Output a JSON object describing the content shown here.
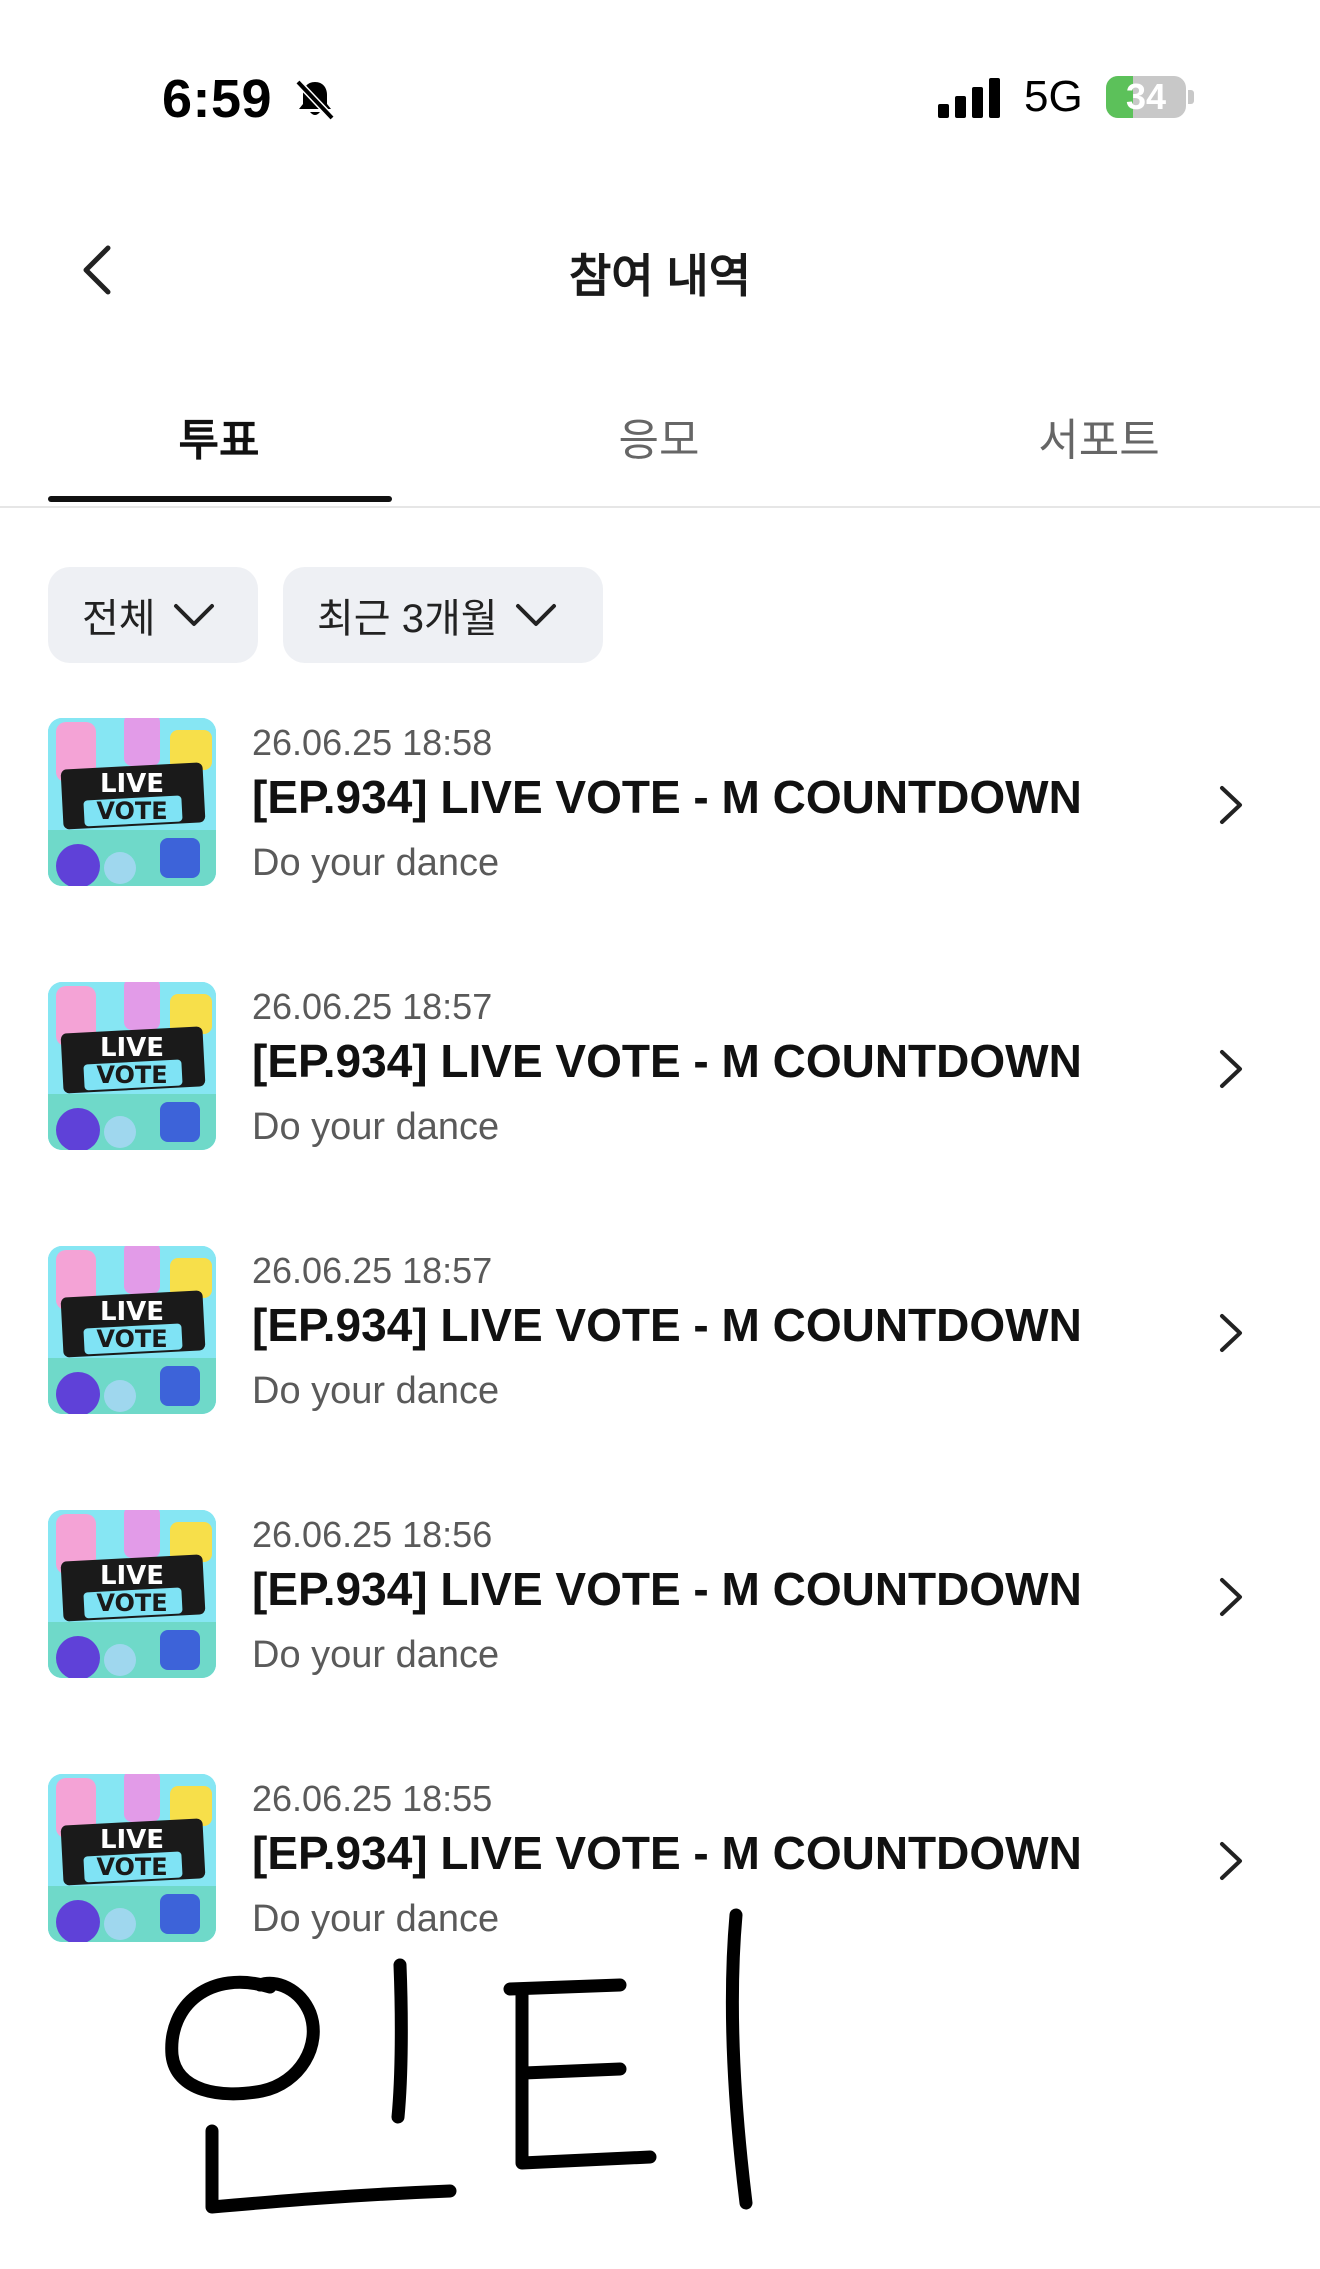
{
  "status_bar": {
    "time": "6:59",
    "network": "5G",
    "battery": "34",
    "battery_level_percent": 34,
    "bell_icon": "bell-slash-icon",
    "signal_icon": "cellular-signal-icon"
  },
  "header": {
    "title": "참여 내역",
    "back_icon": "chevron-left-icon"
  },
  "tabs": [
    {
      "label": "투표",
      "active": true
    },
    {
      "label": "응모",
      "active": false
    },
    {
      "label": "서포트",
      "active": false
    }
  ],
  "filters": [
    {
      "label": "전체",
      "icon": "chevron-down-icon"
    },
    {
      "label": "최근 3개월",
      "icon": "chevron-down-icon"
    }
  ],
  "items": [
    {
      "date": "26.06.25 18:58",
      "title": "[EP.934] LIVE VOTE - M COUNTDOWN",
      "subtitle": "Do your dance",
      "thumb_line1": "LIVE",
      "thumb_line2": "VOTE"
    },
    {
      "date": "26.06.25 18:57",
      "title": "[EP.934] LIVE VOTE - M COUNTDOWN",
      "subtitle": "Do your dance",
      "thumb_line1": "LIVE",
      "thumb_line2": "VOTE"
    },
    {
      "date": "26.06.25 18:57",
      "title": "[EP.934] LIVE VOTE - M COUNTDOWN",
      "subtitle": "Do your dance",
      "thumb_line1": "LIVE",
      "thumb_line2": "VOTE"
    },
    {
      "date": "26.06.25 18:56",
      "title": "[EP.934] LIVE VOTE - M COUNTDOWN",
      "subtitle": "Do your dance",
      "thumb_line1": "LIVE",
      "thumb_line2": "VOTE"
    },
    {
      "date": "26.06.25 18:55",
      "title": "[EP.934] LIVE VOTE - M COUNTDOWN",
      "subtitle": "Do your dance",
      "thumb_line1": "LIVE",
      "thumb_line2": "VOTE"
    }
  ],
  "handwriting": "인티",
  "colors": {
    "accent": "#111111",
    "chip_bg": "#eef0f4",
    "battery_green": "#5cc15a",
    "thumb_cyan": "#7fe3f5"
  }
}
